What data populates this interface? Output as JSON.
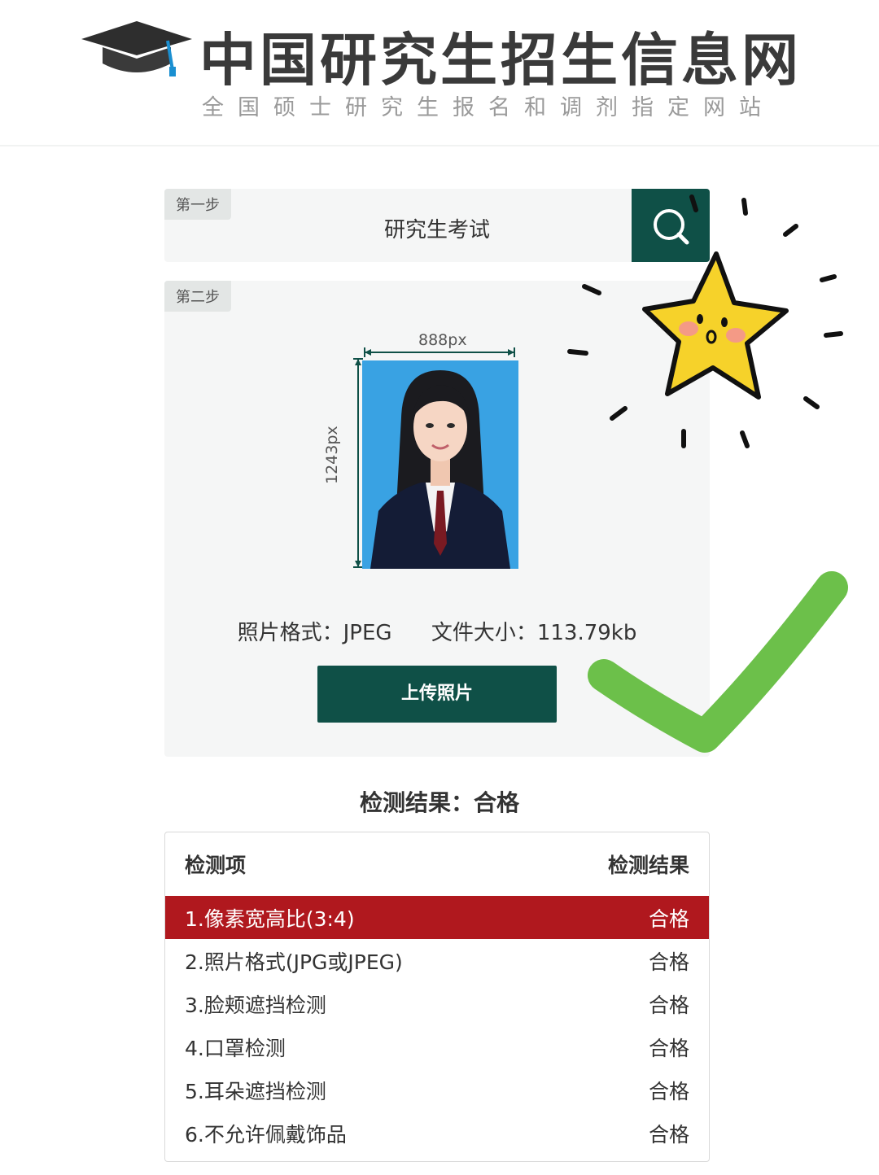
{
  "header": {
    "title": "中国研究生招生信息网",
    "subtitle": "全国硕士研究生报名和调剂指定网站"
  },
  "step1": {
    "badge": "第一步",
    "query": "研究生考试"
  },
  "step2": {
    "badge": "第二步",
    "width_label": "888px",
    "height_label": "1243px",
    "format_text": "照片格式：JPEG",
    "size_text": "文件大小：113.79kb",
    "upload_label": "上传照片"
  },
  "result": {
    "title": "检测结果：合格",
    "columns": [
      "检测项",
      "检测结果"
    ],
    "rows": [
      {
        "item": "1.像素宽高比(3:4)",
        "status": "合格"
      },
      {
        "item": "2.照片格式(JPG或JPEG)",
        "status": "合格"
      },
      {
        "item": "3.脸颊遮挡检测",
        "status": "合格"
      },
      {
        "item": "4.口罩检测",
        "status": "合格"
      },
      {
        "item": "5.耳朵遮挡检测",
        "status": "合格"
      },
      {
        "item": "6.不允许佩戴饰品",
        "status": "合格"
      }
    ]
  },
  "colors": {
    "brand_green": "#0f5047",
    "highlight_red": "#b0181e",
    "photo_bg": "#39a2e3",
    "check_green": "#6cc04a",
    "star_yellow": "#f6d22a"
  },
  "icons": {
    "logo": "graduation-cap-icon",
    "search": "search-icon",
    "decor_star": "star-face-icon",
    "decor_check": "check-mark-icon"
  }
}
